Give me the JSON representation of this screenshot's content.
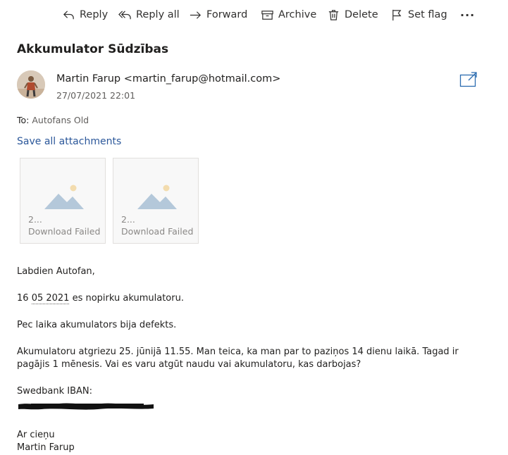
{
  "toolbar": {
    "reply": "Reply",
    "reply_all": "Reply all",
    "forward": "Forward",
    "archive": "Archive",
    "delete": "Delete",
    "set_flag": "Set flag",
    "more": "···"
  },
  "email": {
    "subject": "Akkumulator Sūdzības",
    "sender": "Martin Farup <martin_farup@hotmail.com>",
    "date": "27/07/2021 22:01",
    "to_label": "To:",
    "to_name": "Autofans Old",
    "save_all": "Save all attachments"
  },
  "attachments": [
    {
      "name": "2...",
      "status": "Download Failed"
    },
    {
      "name": "2...",
      "status": "Download Failed"
    }
  ],
  "body": {
    "greeting": "Labdien Autofan,",
    "line1_pre": "16 ",
    "line1_date": "05 2021",
    "line1_post": " es nopirku akumulatoru.",
    "line2": "Pec laika akumulators bija defekts.",
    "line3": "Akumulatoru atgriezu 25. jūnijā 11.55.  Man teica, ka man par to paziņos 14 dienu laikā.  Tagad ir pagājis 1 mēnesis.  Vai es varu atgūt naudu vai akumulatoru, kas darbojas?",
    "iban_label": "Swedbank IBAN:",
    "signoff": "Ar cieņu",
    "signature": "Martin Farup"
  },
  "colors": {
    "link": "#2b579a",
    "muted": "#605e5c",
    "text": "#201f1e"
  }
}
